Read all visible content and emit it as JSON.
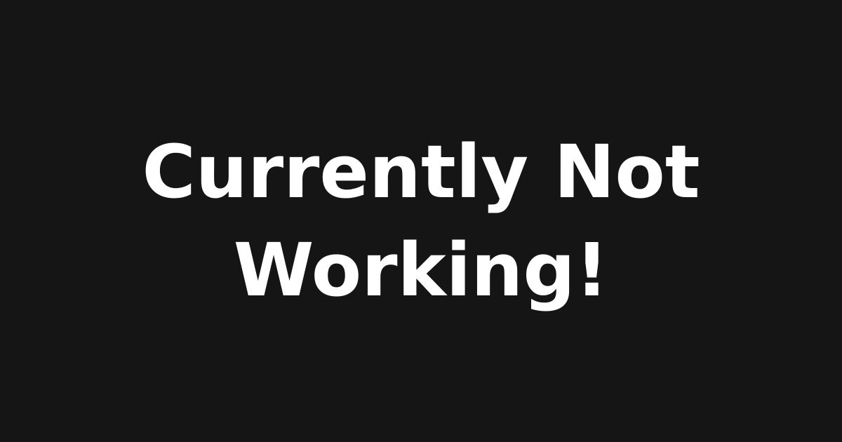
{
  "colors": {
    "background": "#151515",
    "text": "#ffffff"
  },
  "message": {
    "line1": "Currently Not",
    "line2": "Working!"
  }
}
